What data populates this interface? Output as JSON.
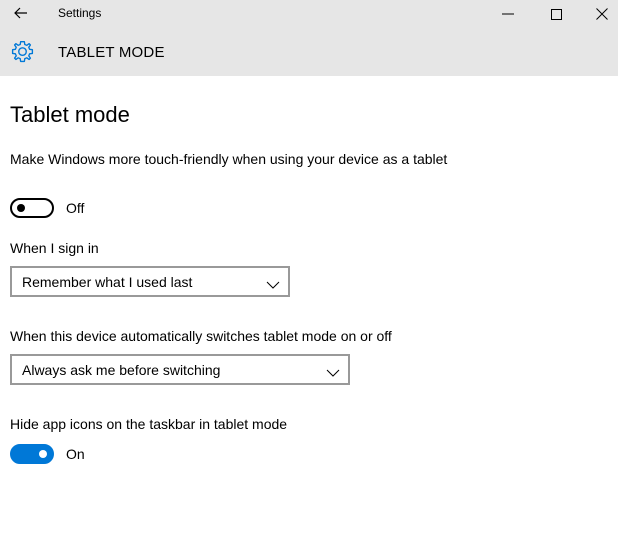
{
  "window": {
    "title": "Settings",
    "back_icon": "back-arrow-icon",
    "controls": [
      "minimize-icon",
      "maximize-icon",
      "close-icon"
    ]
  },
  "header": {
    "icon": "gear-icon",
    "title": "TABLET MODE"
  },
  "main": {
    "page_title": "Tablet mode",
    "touch_friendly": {
      "description": "Make Windows more touch-friendly when using your device as a tablet",
      "state_label": "Off",
      "is_on": false
    },
    "sign_in": {
      "label": "When I sign in",
      "selected": "Remember what I used last"
    },
    "auto_switch": {
      "label": "When this device automatically switches tablet mode on or off",
      "selected": "Always ask me before switching"
    },
    "hide_icons": {
      "description": "Hide app icons on the taskbar in tablet mode",
      "state_label": "On",
      "is_on": true
    }
  },
  "colors": {
    "accent": "#0078d7",
    "header_bg": "#e6e6e6",
    "select_border": "#999999"
  }
}
